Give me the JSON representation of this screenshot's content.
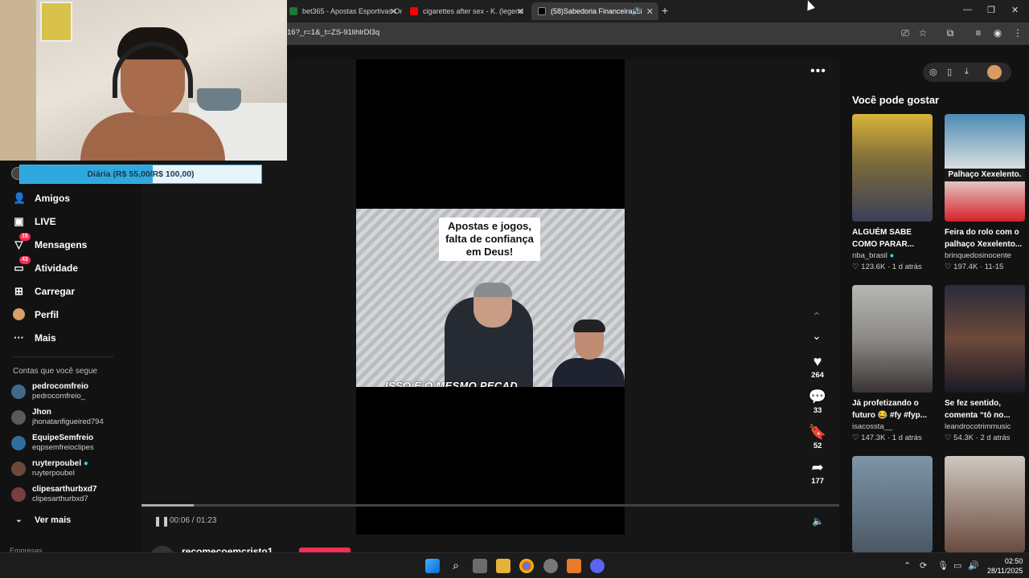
{
  "browser": {
    "tabs": [
      {
        "title": "bet365 - Apostas Esportivas On",
        "color": "#1d7a3c"
      },
      {
        "title": "cigarettes after sex - K. (legend",
        "color": "#ff0000"
      },
      {
        "title": "(58)Sabedoria Financeira: Li",
        "color": "#ffffff"
      }
    ],
    "new_tab": "+",
    "url": "16?_r=1&_t=ZS-91lihlrDl3q",
    "window_controls": [
      "—",
      "❐",
      "✕"
    ]
  },
  "overlay": {
    "goal_text": "Diária (R$ 55,00/R$ 100,00)",
    "goal_progress": 0.55
  },
  "sidebar": {
    "items": [
      {
        "label": "Amigos",
        "icon": "friends-icon",
        "glyph": "👥"
      },
      {
        "label": "LIVE",
        "icon": "live-icon",
        "glyph": "📺"
      },
      {
        "label": "Mensagens",
        "icon": "messages-icon",
        "glyph": "✈",
        "badge": "15"
      },
      {
        "label": "Atividade",
        "icon": "activity-icon",
        "glyph": "💬",
        "badge": "43"
      },
      {
        "label": "Carregar",
        "icon": "upload-icon",
        "glyph": "⊞"
      },
      {
        "label": "Perfil",
        "icon": "profile-icon",
        "glyph": "●"
      },
      {
        "label": "Mais",
        "icon": "more-icon",
        "glyph": "···"
      }
    ],
    "following_title": "Contas que você segue",
    "following": [
      {
        "name": "pedrocomfreio",
        "handle": "pedrocomfreio_"
      },
      {
        "name": "Jhon",
        "handle": "jhonatanfigueired794"
      },
      {
        "name": "EquipeSemfreio",
        "handle": "eqpsemfreioclipes"
      },
      {
        "name": "ruyterpoubel",
        "handle": "ruyterpoubel",
        "verified": true
      },
      {
        "name": "clipesarthurbxd7",
        "handle": "clipesarthurbxd7"
      }
    ],
    "see_more": "Ver mais",
    "footer_cut": "Empresas"
  },
  "video": {
    "caption": "Apostas e jogos, falta de confiança em Deus!",
    "subtitle": "ISSO É O MESMO PECAD",
    "time": "00:06 / 01:23",
    "progress": 0.075,
    "author": "recomecoemcristo1"
  },
  "actions": {
    "likes": "264",
    "comments": "33",
    "saves": "52",
    "shares": "177"
  },
  "recommendations": {
    "title": "Você pode gostar",
    "cards": [
      {
        "title": "ALGUÉM SABE COMO PARAR...",
        "user": "nba_brasil",
        "verified": true,
        "likes": "123.6K",
        "when": "1 d atrás"
      },
      {
        "title": "Feira do rolo com o palhaço Xexelento...",
        "user": "brinquedosinocente",
        "likes": "197.4K",
        "when": "11-15",
        "thumb_label": "Palhaço Xexelento."
      },
      {
        "title": "Já profetizando o futuro 😂 #fy #fyp...",
        "user": "isacossta__",
        "likes": "147.3K",
        "when": "1 d atrás"
      },
      {
        "title": "Se fez sentido, comenta “tô no...",
        "user": "leandrocotrimmusic",
        "likes": "54.3K",
        "when": "2 d atrás"
      }
    ]
  },
  "taskbar": {
    "time": "02:50",
    "date": "28/11/2025"
  }
}
